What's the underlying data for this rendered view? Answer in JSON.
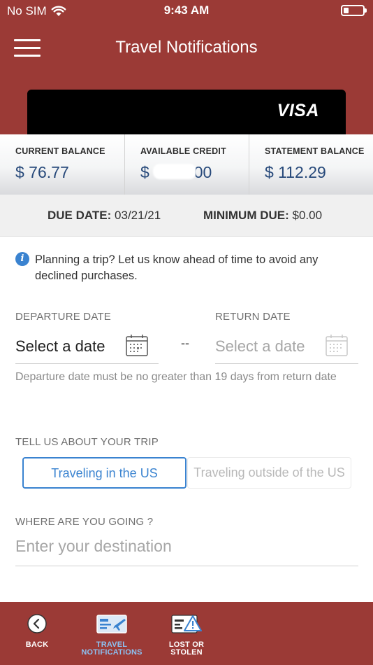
{
  "status_bar": {
    "carrier": "No SIM",
    "time": "9:43 AM",
    "battery_level": 0.25
  },
  "header": {
    "title": "Travel Notifications",
    "menu_icon": "hamburger-menu-icon",
    "card_brand": "VISA"
  },
  "balances": [
    {
      "label": "CURRENT BALANCE",
      "value": "$ 76.77"
    },
    {
      "label": "AVAILABLE CREDIT",
      "value": "$          00"
    },
    {
      "label": "STATEMENT BALANCE",
      "value": "$ 112.29"
    }
  ],
  "due": {
    "due_date_label": "DUE DATE:",
    "due_date_value": "03/21/21",
    "minimum_label": "MINIMUM DUE:",
    "minimum_value": "$0.00"
  },
  "info": {
    "icon": "info-icon",
    "text": "Planning a trip? Let us know ahead of time to avoid any declined purchases."
  },
  "dates": {
    "departure_label": "DEPARTURE DATE",
    "departure_value": "Select a date",
    "separator": "--",
    "return_label": "RETURN DATE",
    "return_value": "Select a date",
    "helper": "Departure date must be no greater than 19 days from return date"
  },
  "trip": {
    "label": "TELL US ABOUT YOUR TRIP",
    "options": [
      "Traveling in the US",
      "Traveling outside of the US"
    ],
    "selected": "Traveling in the US"
  },
  "destination": {
    "label": "WHERE ARE YOU GOING ?",
    "placeholder": "Enter your destination",
    "value": ""
  },
  "bottom_nav": [
    {
      "label_line1": "BACK",
      "label_line2": "",
      "icon": "back-arrow-icon"
    },
    {
      "label_line1": "TRAVEL",
      "label_line2": "NOTIFICATIONS",
      "icon": "travel-ticket-icon",
      "active": true
    },
    {
      "label_line1": "LOST OR",
      "label_line2": "STOLEN",
      "icon": "lost-card-warning-icon"
    }
  ],
  "colors": {
    "brand": "#9b3a36",
    "accent": "#3a83d0",
    "value_text": "#27497a",
    "active_tab": "#8cc0f0"
  }
}
